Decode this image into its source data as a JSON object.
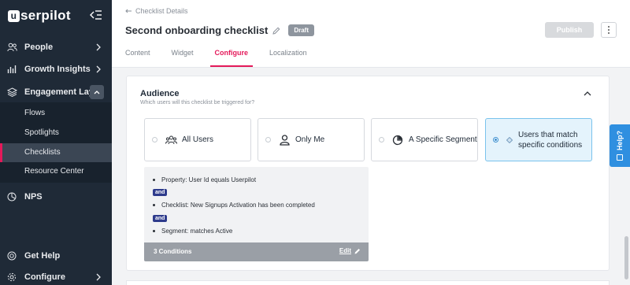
{
  "brand": {
    "logo_text": "serpilot",
    "logo_letter": "u"
  },
  "sidebar": {
    "items": [
      {
        "label": "People"
      },
      {
        "label": "Growth Insights"
      },
      {
        "label": "Engagement Layer"
      },
      {
        "label": "NPS"
      },
      {
        "label": "Get Help"
      },
      {
        "label": "Configure"
      }
    ],
    "sub_items": [
      {
        "label": "Flows"
      },
      {
        "label": "Spotlights"
      },
      {
        "label": "Checklists"
      },
      {
        "label": "Resource Center"
      }
    ]
  },
  "header": {
    "back_label": "Checklist Details",
    "title": "Second onboarding checklist",
    "status": "Draft",
    "publish_label": "Publish",
    "tabs": [
      {
        "label": "Content"
      },
      {
        "label": "Widget"
      },
      {
        "label": "Configure"
      },
      {
        "label": "Localization"
      }
    ],
    "active_tab": "Configure"
  },
  "audience": {
    "title": "Audience",
    "subtitle": "Which users will this checklist be triggered for?",
    "options": [
      {
        "label": "All Users",
        "icon": "users-icon",
        "selected": false
      },
      {
        "label": "Only Me",
        "icon": "user-icon",
        "selected": false
      },
      {
        "label": "A Specific Segment",
        "icon": "pie-chart-icon",
        "selected": false
      },
      {
        "label": "Users that match specific conditions",
        "icon": "diamond-icon",
        "selected": true
      }
    ],
    "conditions": [
      "Property: User Id equals Userpilot",
      "Checklist: New Signups Activation has been completed",
      "Segment: matches Active"
    ],
    "and_label": "and",
    "count_label": "3 Conditions",
    "edit_label": "Edit"
  },
  "help_tab": {
    "label": "Help?"
  },
  "colors": {
    "accent": "#e4195a",
    "sidebar": "#1f2a37",
    "selected": "#e4f3fc",
    "and_badge": "#2e3b8c"
  }
}
